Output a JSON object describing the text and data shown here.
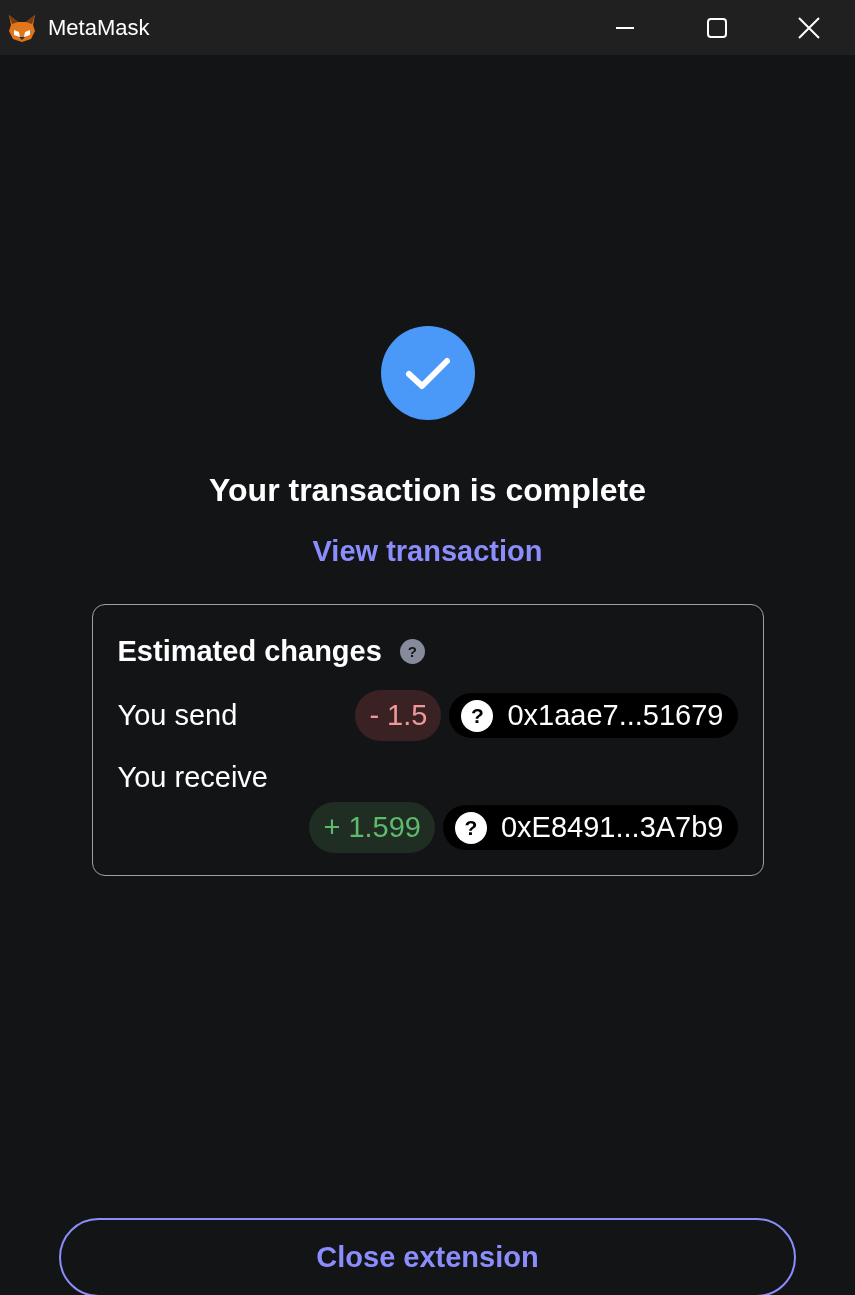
{
  "window": {
    "title": "MetaMask"
  },
  "status": {
    "title": "Your transaction is complete",
    "link": "View transaction"
  },
  "changes": {
    "title": "Estimated changes",
    "help": "?",
    "rows": [
      {
        "label": "You send",
        "kind": "debit",
        "amount": "- 1.5",
        "token_icon": "?",
        "token": "0x1aae7...51679"
      },
      {
        "label": "You receive",
        "kind": "credit",
        "amount": "+ 1.599",
        "token_icon": "?",
        "token": "0xE8491...3A7b9"
      }
    ]
  },
  "footer": {
    "button": "Close extension"
  }
}
